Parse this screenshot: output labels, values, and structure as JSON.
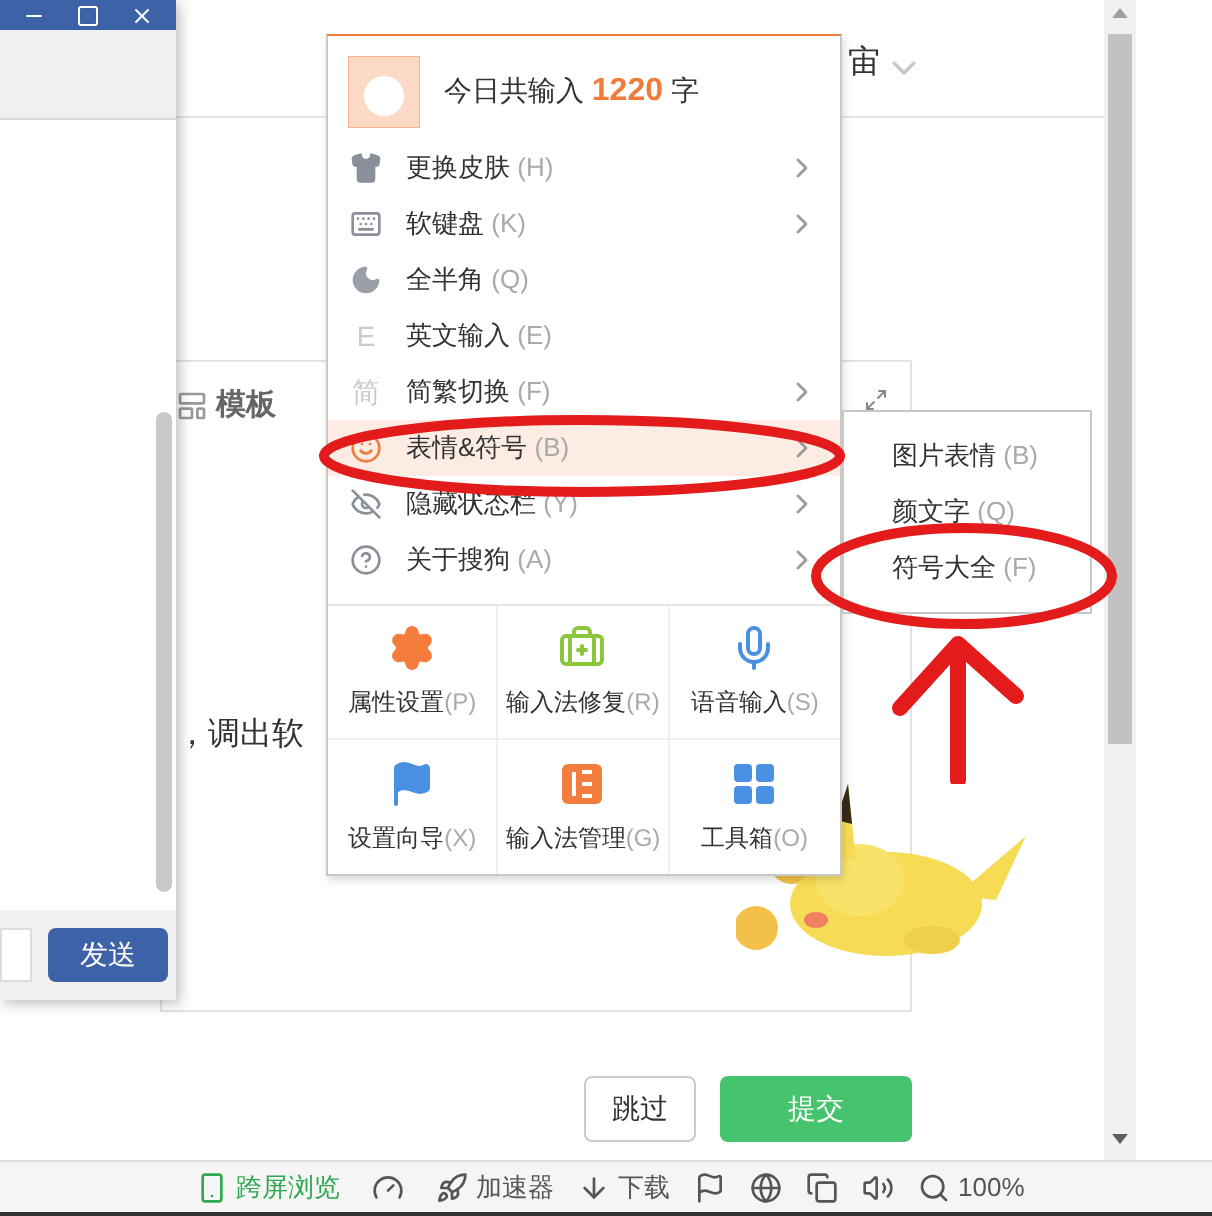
{
  "chat_window": {
    "send_button": "发送"
  },
  "page": {
    "header_text": "宙",
    "template_button": "模板",
    "body_text": "，调出软",
    "skip_button": "跳过",
    "submit_button": "提交"
  },
  "menu": {
    "header": {
      "prefix": "今日共输入",
      "count": "1220",
      "suffix": "字"
    },
    "items": [
      {
        "label": "更换皮肤",
        "shortcut": "(H)",
        "submenu": true,
        "selected": false
      },
      {
        "label": "软键盘",
        "shortcut": "(K)",
        "submenu": true,
        "selected": false
      },
      {
        "label": "全半角",
        "shortcut": "(Q)",
        "submenu": false,
        "selected": false
      },
      {
        "label": "英文输入",
        "shortcut": "(E)",
        "submenu": false,
        "selected": false,
        "glyph": "E"
      },
      {
        "label": "简繁切换",
        "shortcut": "(F)",
        "submenu": true,
        "selected": false,
        "glyph": "简"
      },
      {
        "label": "表情&符号",
        "shortcut": "(B)",
        "submenu": true,
        "selected": true
      },
      {
        "label": "隐藏状态栏",
        "shortcut": "(Y)",
        "submenu": true,
        "selected": false
      },
      {
        "label": "关于搜狗",
        "shortcut": "(A)",
        "submenu": true,
        "selected": false
      }
    ],
    "tools": [
      {
        "label": "属性设置",
        "shortcut": "(P)"
      },
      {
        "label": "输入法修复",
        "shortcut": "(R)"
      },
      {
        "label": "语音输入",
        "shortcut": "(S)"
      },
      {
        "label": "设置向导",
        "shortcut": "(X)"
      },
      {
        "label": "输入法管理",
        "shortcut": "(G)"
      },
      {
        "label": "工具箱",
        "shortcut": "(O)"
      }
    ]
  },
  "submenu": {
    "items": [
      {
        "label": "图片表情",
        "shortcut": "(B)"
      },
      {
        "label": "颜文字",
        "shortcut": "(Q)"
      },
      {
        "label": "符号大全",
        "shortcut": "(F)"
      }
    ]
  },
  "status_bar": {
    "cross_screen": "跨屏浏览",
    "accelerator": "加速器",
    "download": "下载",
    "zoom": "100%"
  }
}
